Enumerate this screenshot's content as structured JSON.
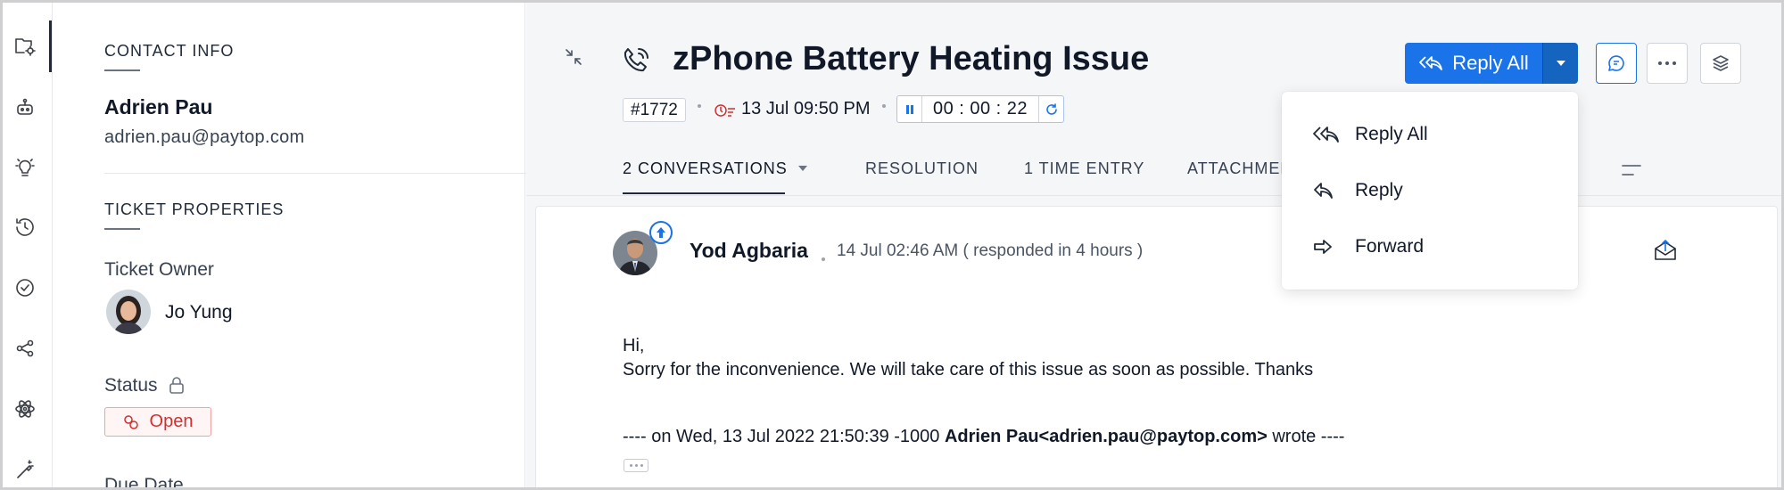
{
  "contact": {
    "section_title": "CONTACT INFO",
    "name": "Adrien Pau",
    "email": "adrien.pau@paytop.com"
  },
  "ticket_properties": {
    "section_title": "TICKET PROPERTIES",
    "owner_label": "Ticket Owner",
    "owner_name": "Jo Yung",
    "status_label": "Status",
    "status_value": "Open",
    "due_label": "Due Date"
  },
  "header": {
    "title": "zPhone Battery Heating Issue",
    "ticket_id": "#1772",
    "due_time": "13 Jul 09:50 PM",
    "timer": "00 : 00 : 22"
  },
  "actions": {
    "reply_all_label": "Reply All"
  },
  "tabs": [
    {
      "label": "2 CONVERSATIONS"
    },
    {
      "label": "RESOLUTION"
    },
    {
      "label": "1 TIME ENTRY"
    },
    {
      "label": "ATTACHMENTS"
    }
  ],
  "reply_menu": [
    {
      "label": "Reply All",
      "icon": "reply-all-icon"
    },
    {
      "label": "Reply",
      "icon": "reply-icon"
    },
    {
      "label": "Forward",
      "icon": "forward-icon"
    }
  ],
  "conversation": {
    "sender": "Yod Agbaria",
    "time": "14 Jul 02:46 AM ( responded in 4 hours )",
    "greeting": "Hi,",
    "body": "Sorry for the inconvenience. We will take care of this issue as soon as possible. Thanks",
    "quote_prefix": "---- on Wed, 13 Jul 2022 21:50:39 -1000 ",
    "quote_author": "Adrien Pau<adrien.pau@paytop.com>",
    "quote_suffix": " wrote ----"
  },
  "colors": {
    "primary": "#1a73e8",
    "primary_dark": "#1565c0",
    "status_open": "#d32f2f",
    "main_bg": "#f5f6f8"
  }
}
